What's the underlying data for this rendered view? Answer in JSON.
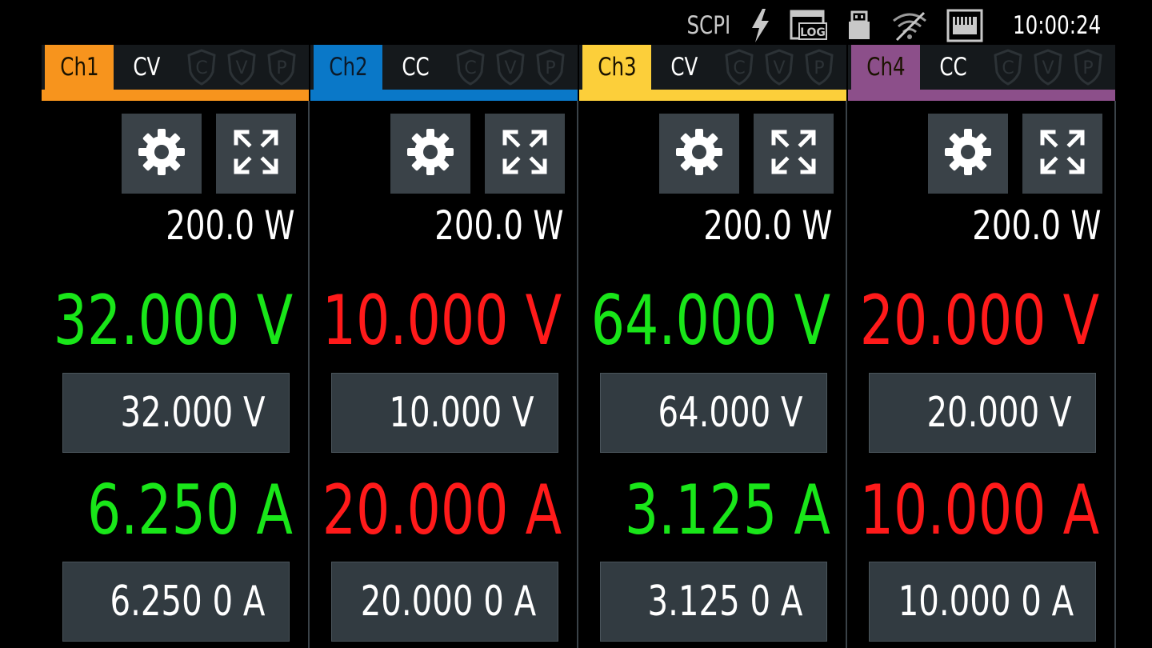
{
  "status_bar": {
    "scpi_label": "SCPI",
    "icons": [
      "lightning-icon",
      "log-icon",
      "usb-icon",
      "wifi-disabled-icon",
      "lan-icon"
    ],
    "log_label": "LOG",
    "time": "10:00:24"
  },
  "protection_labels": [
    "C",
    "V",
    "P"
  ],
  "channels": [
    {
      "label": "Ch1",
      "mode": "CV",
      "color": "#f7941d",
      "mode_color": "#19e619",
      "power_limit": "200.0 W",
      "measured_voltage": "32.000 V",
      "set_voltage": "32.000  V",
      "measured_current": "6.250 A",
      "set_current": "6.250 0  A"
    },
    {
      "label": "Ch2",
      "mode": "CC",
      "color": "#0a78c8",
      "mode_color": "#ff1a1a",
      "power_limit": "200.0 W",
      "measured_voltage": "10.000 V",
      "set_voltage": "10.000  V",
      "measured_current": "20.000 A",
      "set_current": "20.000 0 A"
    },
    {
      "label": "Ch3",
      "mode": "CV",
      "color": "#fccf3a",
      "mode_color": "#19e619",
      "power_limit": "200.0 W",
      "measured_voltage": "64.000 V",
      "set_voltage": "64.000  V",
      "measured_current": "3.125 A",
      "set_current": "3.125 0  A"
    },
    {
      "label": "Ch4",
      "mode": "CC",
      "color": "#8c4f8a",
      "mode_color": "#ff1a1a",
      "power_limit": "200.0 W",
      "measured_voltage": "20.000 V",
      "set_voltage": "20.000  V",
      "measured_current": "10.000 A",
      "set_current": "10.000 0 A"
    }
  ]
}
